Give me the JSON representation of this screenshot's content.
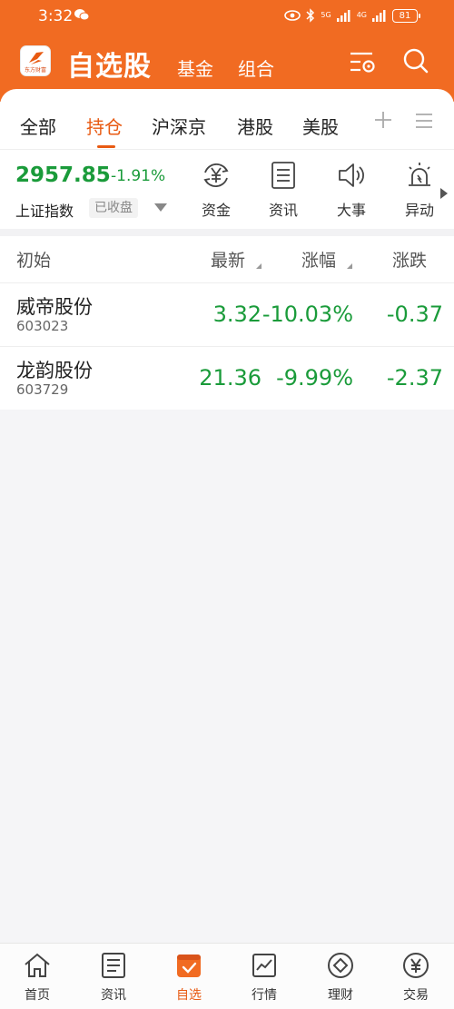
{
  "status_bar": {
    "time": "3:32",
    "net1": "5G",
    "net2": "4G",
    "battery": "81"
  },
  "header": {
    "logo_text": "东方财富",
    "title": "自选股",
    "nav": [
      "基金",
      "组合"
    ],
    "accent_color": "#f16b22"
  },
  "tabs": {
    "items": [
      "全部",
      "持仓",
      "沪深京",
      "港股",
      "美股"
    ],
    "active": "持仓"
  },
  "index": {
    "value": "2957.85",
    "change": "-1.91%",
    "name": "上证指数",
    "status": "已收盘"
  },
  "quick_links": [
    {
      "label": "资金",
      "icon": "yuan-cycle-icon"
    },
    {
      "label": "资讯",
      "icon": "document-icon"
    },
    {
      "label": "大事",
      "icon": "speaker-icon"
    },
    {
      "label": "异动",
      "icon": "alarm-icon"
    }
  ],
  "list": {
    "columns": [
      "初始",
      "最新",
      "涨幅",
      "涨跌"
    ],
    "rows": [
      {
        "name": "威帝股份",
        "code": "603023",
        "price": "3.32",
        "pct": "-10.03%",
        "change": "-0.37"
      },
      {
        "name": "龙韵股份",
        "code": "603729",
        "price": "21.36",
        "pct": "-9.99%",
        "change": "-2.37"
      }
    ],
    "down_color": "#1a9b3a"
  },
  "bottom_nav": {
    "items": [
      "首页",
      "资讯",
      "自选",
      "行情",
      "理财",
      "交易"
    ],
    "active": "自选"
  }
}
